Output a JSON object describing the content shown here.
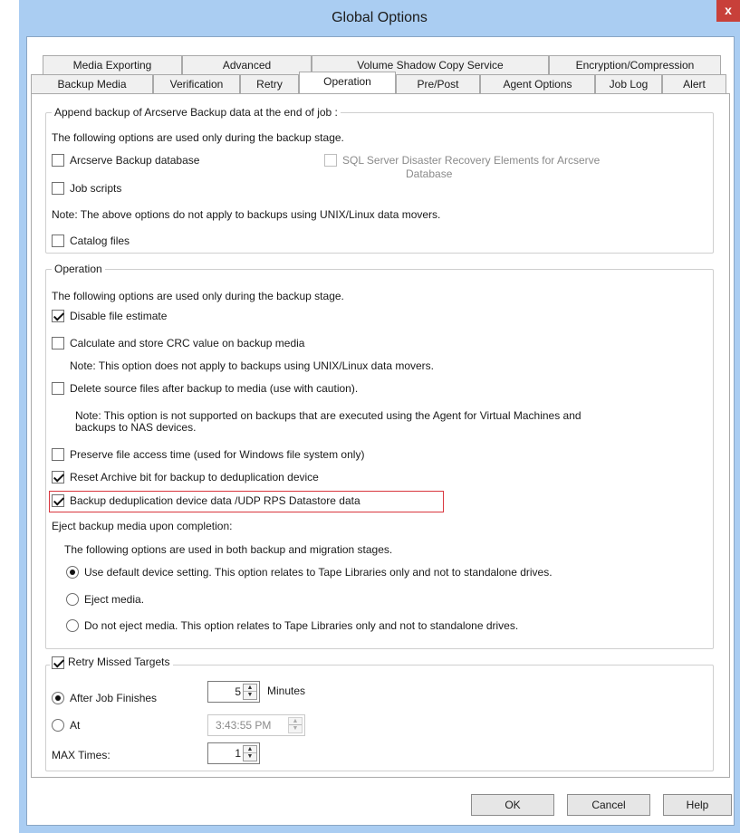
{
  "window": {
    "title": "Global Options",
    "close_label": "x"
  },
  "tabs": {
    "row1": [
      "Media Exporting",
      "Advanced",
      "Volume Shadow Copy Service",
      "Encryption/Compression"
    ],
    "row2": [
      "Backup Media",
      "Verification",
      "Retry",
      "Operation",
      "Pre/Post",
      "Agent Options",
      "Job Log",
      "Alert"
    ],
    "active": "Operation"
  },
  "append_group": {
    "legend": "Append backup of Arcserve Backup data at the end of job :",
    "intro": "The following options are used only during the backup stage.",
    "arcserve_db": {
      "label": "Arcserve Backup database",
      "checked": false
    },
    "sql_dr": {
      "label_line1": "SQL Server Disaster Recovery Elements for Arcserve",
      "label_line2": "Database",
      "checked": false,
      "enabled": false
    },
    "job_scripts": {
      "label": "Job scripts",
      "checked": false
    },
    "note": "Note: The above options do not apply to backups using UNIX/Linux data movers.",
    "catalog_files": {
      "label": "Catalog files",
      "checked": false
    }
  },
  "operation_group": {
    "legend": "Operation",
    "intro": "The following options are used only during the backup stage.",
    "disable_estimate": {
      "label": "Disable file estimate",
      "checked": true
    },
    "calc_crc": {
      "label": "Calculate and store CRC value on backup media",
      "checked": false
    },
    "crc_note": "Note: This option does not apply to backups using UNIX/Linux data movers.",
    "delete_source": {
      "label": "Delete source files after backup to media (use with caution).",
      "checked": false
    },
    "delete_note_line1": "Note: This option is not supported on backups that are executed using the Agent for Virtual Machines and",
    "delete_note_line2": "backups to NAS devices.",
    "preserve_access": {
      "label": "Preserve file access time (used for Windows file system only)",
      "checked": false
    },
    "reset_archive": {
      "label": "Reset Archive bit for backup to deduplication device",
      "checked": true
    },
    "backup_dedup": {
      "label": "Backup deduplication device data /UDP RPS Datastore data",
      "checked": true
    },
    "eject_heading": "Eject backup media upon completion:",
    "eject_intro": "The following options are used in both backup and migration stages.",
    "eject_default": {
      "label": "Use default device setting. This option relates to Tape Libraries only and not to standalone drives.",
      "selected": true
    },
    "eject_media": {
      "label": "Eject media.",
      "selected": false
    },
    "no_eject": {
      "label": "Do not eject media. This option relates to Tape Libraries only and not to standalone drives.",
      "selected": false
    }
  },
  "retry_group": {
    "legend": "Retry Missed Targets",
    "checked": true,
    "after_job": {
      "label": "After Job Finishes",
      "selected": true,
      "value": "5",
      "unit": "Minutes"
    },
    "at": {
      "label": "At",
      "selected": false,
      "value": "3:43:55 PM"
    },
    "max_times": {
      "label": "MAX Times:",
      "value": "1"
    }
  },
  "buttons": {
    "ok": "OK",
    "cancel": "Cancel",
    "help": "Help"
  },
  "colors": {
    "window_frame": "#aacdf2",
    "highlight_border": "#d9363e"
  },
  "icons": {
    "close": "close-icon",
    "spin_up": "chevron-up-icon",
    "spin_down": "chevron-down-icon"
  }
}
